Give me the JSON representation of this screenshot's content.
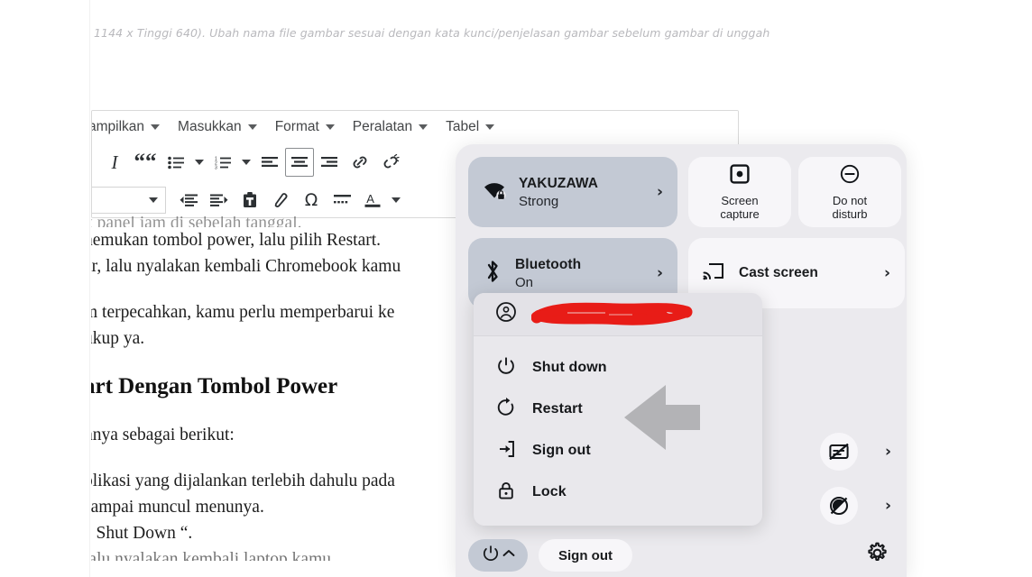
{
  "caption": "1144 x Tinggi 640). Ubah nama file gambar sesuai dengan kata kunci/penjelasan gambar sebelum gambar di unggah",
  "editor": {
    "menus": [
      {
        "label": "ampilkan"
      },
      {
        "label": "Masukkan"
      },
      {
        "label": "Format"
      },
      {
        "label": "Peralatan"
      },
      {
        "label": "Tabel"
      }
    ],
    "toolbar_row1": [
      {
        "name": "italic",
        "glyph": "I"
      },
      {
        "name": "blockquote",
        "glyph": "““"
      },
      {
        "name": "bulleted-list",
        "glyph": ""
      },
      {
        "name": "bulleted-list-options",
        "glyph": ""
      },
      {
        "name": "numbered-list",
        "glyph": ""
      },
      {
        "name": "numbered-list-options",
        "glyph": ""
      },
      {
        "name": "align-left",
        "glyph": ""
      },
      {
        "name": "align-center",
        "glyph": ""
      },
      {
        "name": "align-right",
        "glyph": ""
      },
      {
        "name": "insert-link",
        "glyph": ""
      },
      {
        "name": "remove-link",
        "glyph": ""
      }
    ],
    "toolbar_row2": [
      {
        "name": "style-select",
        "glyph": ""
      },
      {
        "name": "decrease-indent",
        "glyph": ""
      },
      {
        "name": "increase-indent",
        "glyph": ""
      },
      {
        "name": "paste",
        "glyph": ""
      },
      {
        "name": "clear-format",
        "glyph": ""
      },
      {
        "name": "special-character",
        "glyph": "Ω"
      },
      {
        "name": "horizontal-rule",
        "glyph": ""
      },
      {
        "name": "text-color",
        "glyph": "A"
      },
      {
        "name": "text-color-options",
        "glyph": ""
      }
    ]
  },
  "document": {
    "line_clipped_top": "k panel jam di sebelah tanggal.",
    "lines_1": [
      "nemukan tombol power, lalu pilih Restart.",
      "ar, lalu nyalakan kembali Chromebook kamu"
    ],
    "lines_2": [
      "m terpecahkan, kamu perlu memperbarui ke",
      "ukup ya."
    ],
    "heading": "art Dengan Tombol Power",
    "lines_3": [
      "hnya sebagai berikut:"
    ],
    "lines_4": [
      "plikasi yang dijalankan terlebih dahulu pada",
      "sampai muncul menunya.",
      "“ Shut Down “."
    ],
    "line_clipped_bottom": "lalu nyalakan kembali laptop kamu"
  },
  "quick_settings": {
    "wifi": {
      "title": "YAKUZAWA",
      "subtitle": "Strong",
      "chevron": "›"
    },
    "bluetooth": {
      "title": "Bluetooth",
      "subtitle": "On",
      "chevron": "›"
    },
    "screen_capture": {
      "label": "Screen\ncapture"
    },
    "do_not_disturb": {
      "label": "Do not\ndisturb"
    },
    "cast_screen": {
      "label": "Cast screen",
      "chevron": "›"
    },
    "mini_rows": [
      {
        "name": "captions-off",
        "chevron": "›"
      },
      {
        "name": "screen-rotation-lock",
        "chevron": "›"
      }
    ],
    "bottom": {
      "sign_out_label": "Sign out",
      "power_chevron": "^"
    },
    "colors": {
      "panel_bg": "#ebeaee",
      "tile_active": "#c3c9d4",
      "tile_idle": "#f7f6f9",
      "scribble": "#e81c17"
    }
  },
  "power_menu": {
    "user_row_redacted": "",
    "items": [
      {
        "icon": "power-icon",
        "label": "Shut down"
      },
      {
        "icon": "restart-icon",
        "label": "Restart"
      },
      {
        "icon": "sign-out-icon",
        "label": "Sign out"
      },
      {
        "icon": "lock-icon",
        "label": "Lock"
      }
    ]
  }
}
